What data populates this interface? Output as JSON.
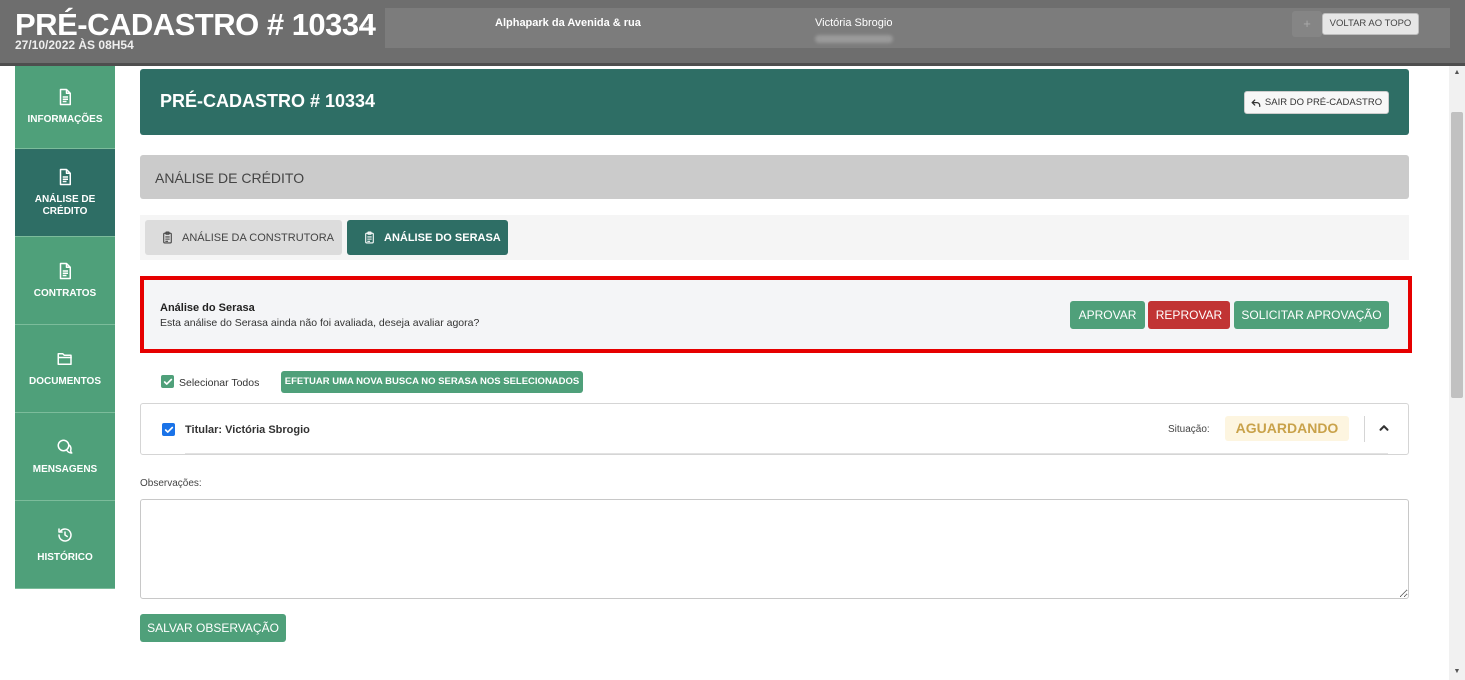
{
  "topbar": {
    "title": "PRÉ-CADASTRO # 10334",
    "date": "27/10/2022 ÀS 08H54",
    "ghost_text": "os",
    "enterprise": "Alphapark da Avenida & rua",
    "client_name": "Victória Sbrogio",
    "back_to_top": "VOLTAR AO TOPO",
    "add_icon": "+"
  },
  "sidebar": {
    "items": [
      {
        "label": "INFORMAÇÕES",
        "icon": "document-icon"
      },
      {
        "label": "ANÁLISE DE CRÉDITO",
        "icon": "document-icon"
      },
      {
        "label": "CONTRATOS",
        "icon": "document-icon"
      },
      {
        "label": "DOCUMENTOS",
        "icon": "folder-icon"
      },
      {
        "label": "MENSAGENS",
        "icon": "chat-icon"
      },
      {
        "label": "HISTÓRICO",
        "icon": "history-icon"
      }
    ]
  },
  "header": {
    "title": "PRÉ-CADASTRO # 10334",
    "exit_label": "SAIR DO PRÉ-CADASTRO"
  },
  "section": {
    "title": "ANÁLISE DE CRÉDITO"
  },
  "tabs": [
    {
      "label": "ANÁLISE DA CONSTRUTORA",
      "icon": "clipboard-icon"
    },
    {
      "label": "ANÁLISE DO SERASA",
      "icon": "clipboard-icon"
    }
  ],
  "analysis": {
    "title": "Análise do Serasa",
    "description": "Esta análise do Serasa ainda não foi avaliada, deseja avaliar agora?",
    "approve_label": "APROVAR",
    "reject_label": "REPROVAR",
    "request_label": "SOLICITAR APROVAÇÃO"
  },
  "selection": {
    "select_all_label": "Selecionar Todos",
    "select_all_checked": true,
    "search_button_label": "EFETUAR UMA NOVA BUSCA NO SERASA NOS SELECIONADOS"
  },
  "holder": {
    "label": "Titular: Victória Sbrogio",
    "checked": true,
    "status_label": "Situação:",
    "status_value": "AGUARDANDO"
  },
  "observations": {
    "label": "Observações:",
    "value": "",
    "save_label": "SALVAR OBSERVAÇÃO"
  },
  "colors": {
    "primary_dark": "#2e6e65",
    "primary": "#4fa07a",
    "danger": "#c13434",
    "highlight": "#e60000",
    "pending_text": "#c9a24a",
    "pending_bg": "#fdf5e0"
  }
}
